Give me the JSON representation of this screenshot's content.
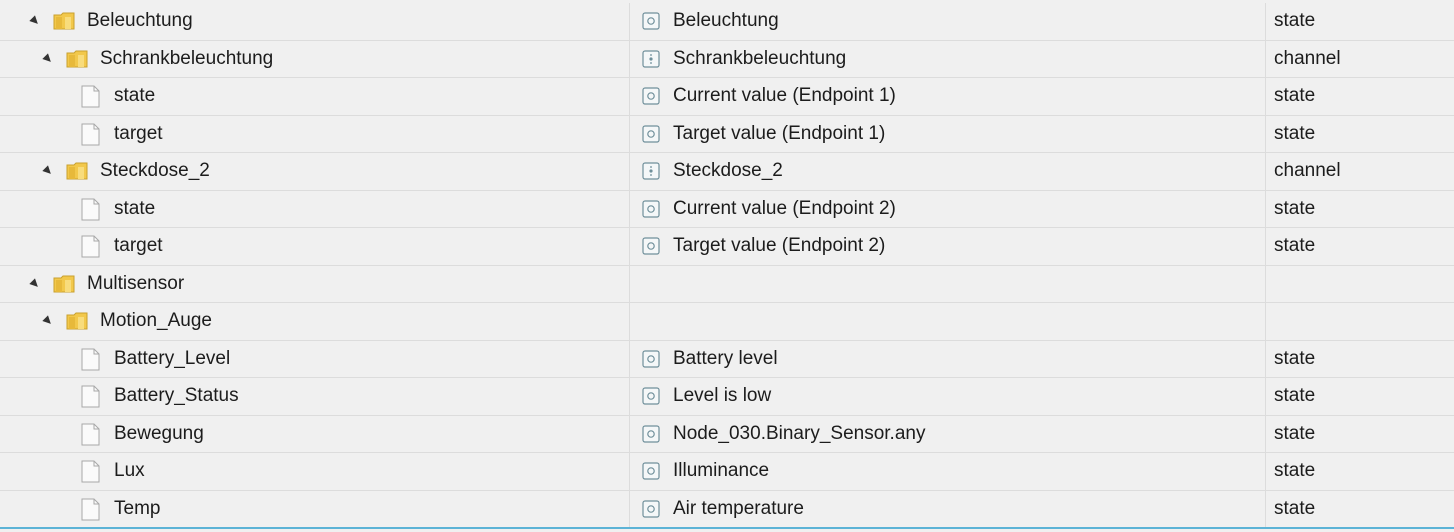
{
  "rows": [
    {
      "depth": 1,
      "kind": "folder",
      "name": "Beleuchtung",
      "icon": "state-icon",
      "desc": "Beleuchtung",
      "type": "state"
    },
    {
      "depth": 2,
      "kind": "folder",
      "name": "Schrankbeleuchtung",
      "icon": "channel-icon",
      "desc": "Schrankbeleuchtung",
      "type": "channel"
    },
    {
      "depth": 3,
      "kind": "file",
      "name": "state",
      "icon": "state-icon",
      "desc": "Current value (Endpoint 1)",
      "type": "state"
    },
    {
      "depth": 3,
      "kind": "file",
      "name": "target",
      "icon": "state-icon",
      "desc": "Target value (Endpoint 1)",
      "type": "state"
    },
    {
      "depth": 2,
      "kind": "folder",
      "name": "Steckdose_2",
      "icon": "channel-icon",
      "desc": "Steckdose_2",
      "type": "channel"
    },
    {
      "depth": 3,
      "kind": "file",
      "name": "state",
      "icon": "state-icon",
      "desc": "Current value (Endpoint 2)",
      "type": "state"
    },
    {
      "depth": 3,
      "kind": "file",
      "name": "target",
      "icon": "state-icon",
      "desc": "Target value (Endpoint 2)",
      "type": "state"
    },
    {
      "depth": 1,
      "kind": "folder",
      "name": "Multisensor",
      "icon": "",
      "desc": "",
      "type": ""
    },
    {
      "depth": 2,
      "kind": "folder",
      "name": "Motion_Auge",
      "icon": "",
      "desc": "",
      "type": ""
    },
    {
      "depth": 3,
      "kind": "file",
      "name": "Battery_Level",
      "icon": "state-icon",
      "desc": "Battery level",
      "type": "state"
    },
    {
      "depth": 3,
      "kind": "file",
      "name": "Battery_Status",
      "icon": "state-icon",
      "desc": "Level is low",
      "type": "state"
    },
    {
      "depth": 3,
      "kind": "file",
      "name": "Bewegung",
      "icon": "state-icon",
      "desc": "Node_030.Binary_Sensor.any",
      "type": "state"
    },
    {
      "depth": 3,
      "kind": "file",
      "name": "Lux",
      "icon": "state-icon",
      "desc": "Illuminance",
      "type": "state"
    },
    {
      "depth": 3,
      "kind": "file",
      "name": "Temp",
      "icon": "state-icon",
      "desc": "Air temperature",
      "type": "state"
    }
  ],
  "colors": {
    "background": "#f0f0f0",
    "divider": "#dcdcdc",
    "icon_stroke": "#6f8f9a",
    "folder": "#f2c84b",
    "accent": "#5cb3d6"
  }
}
